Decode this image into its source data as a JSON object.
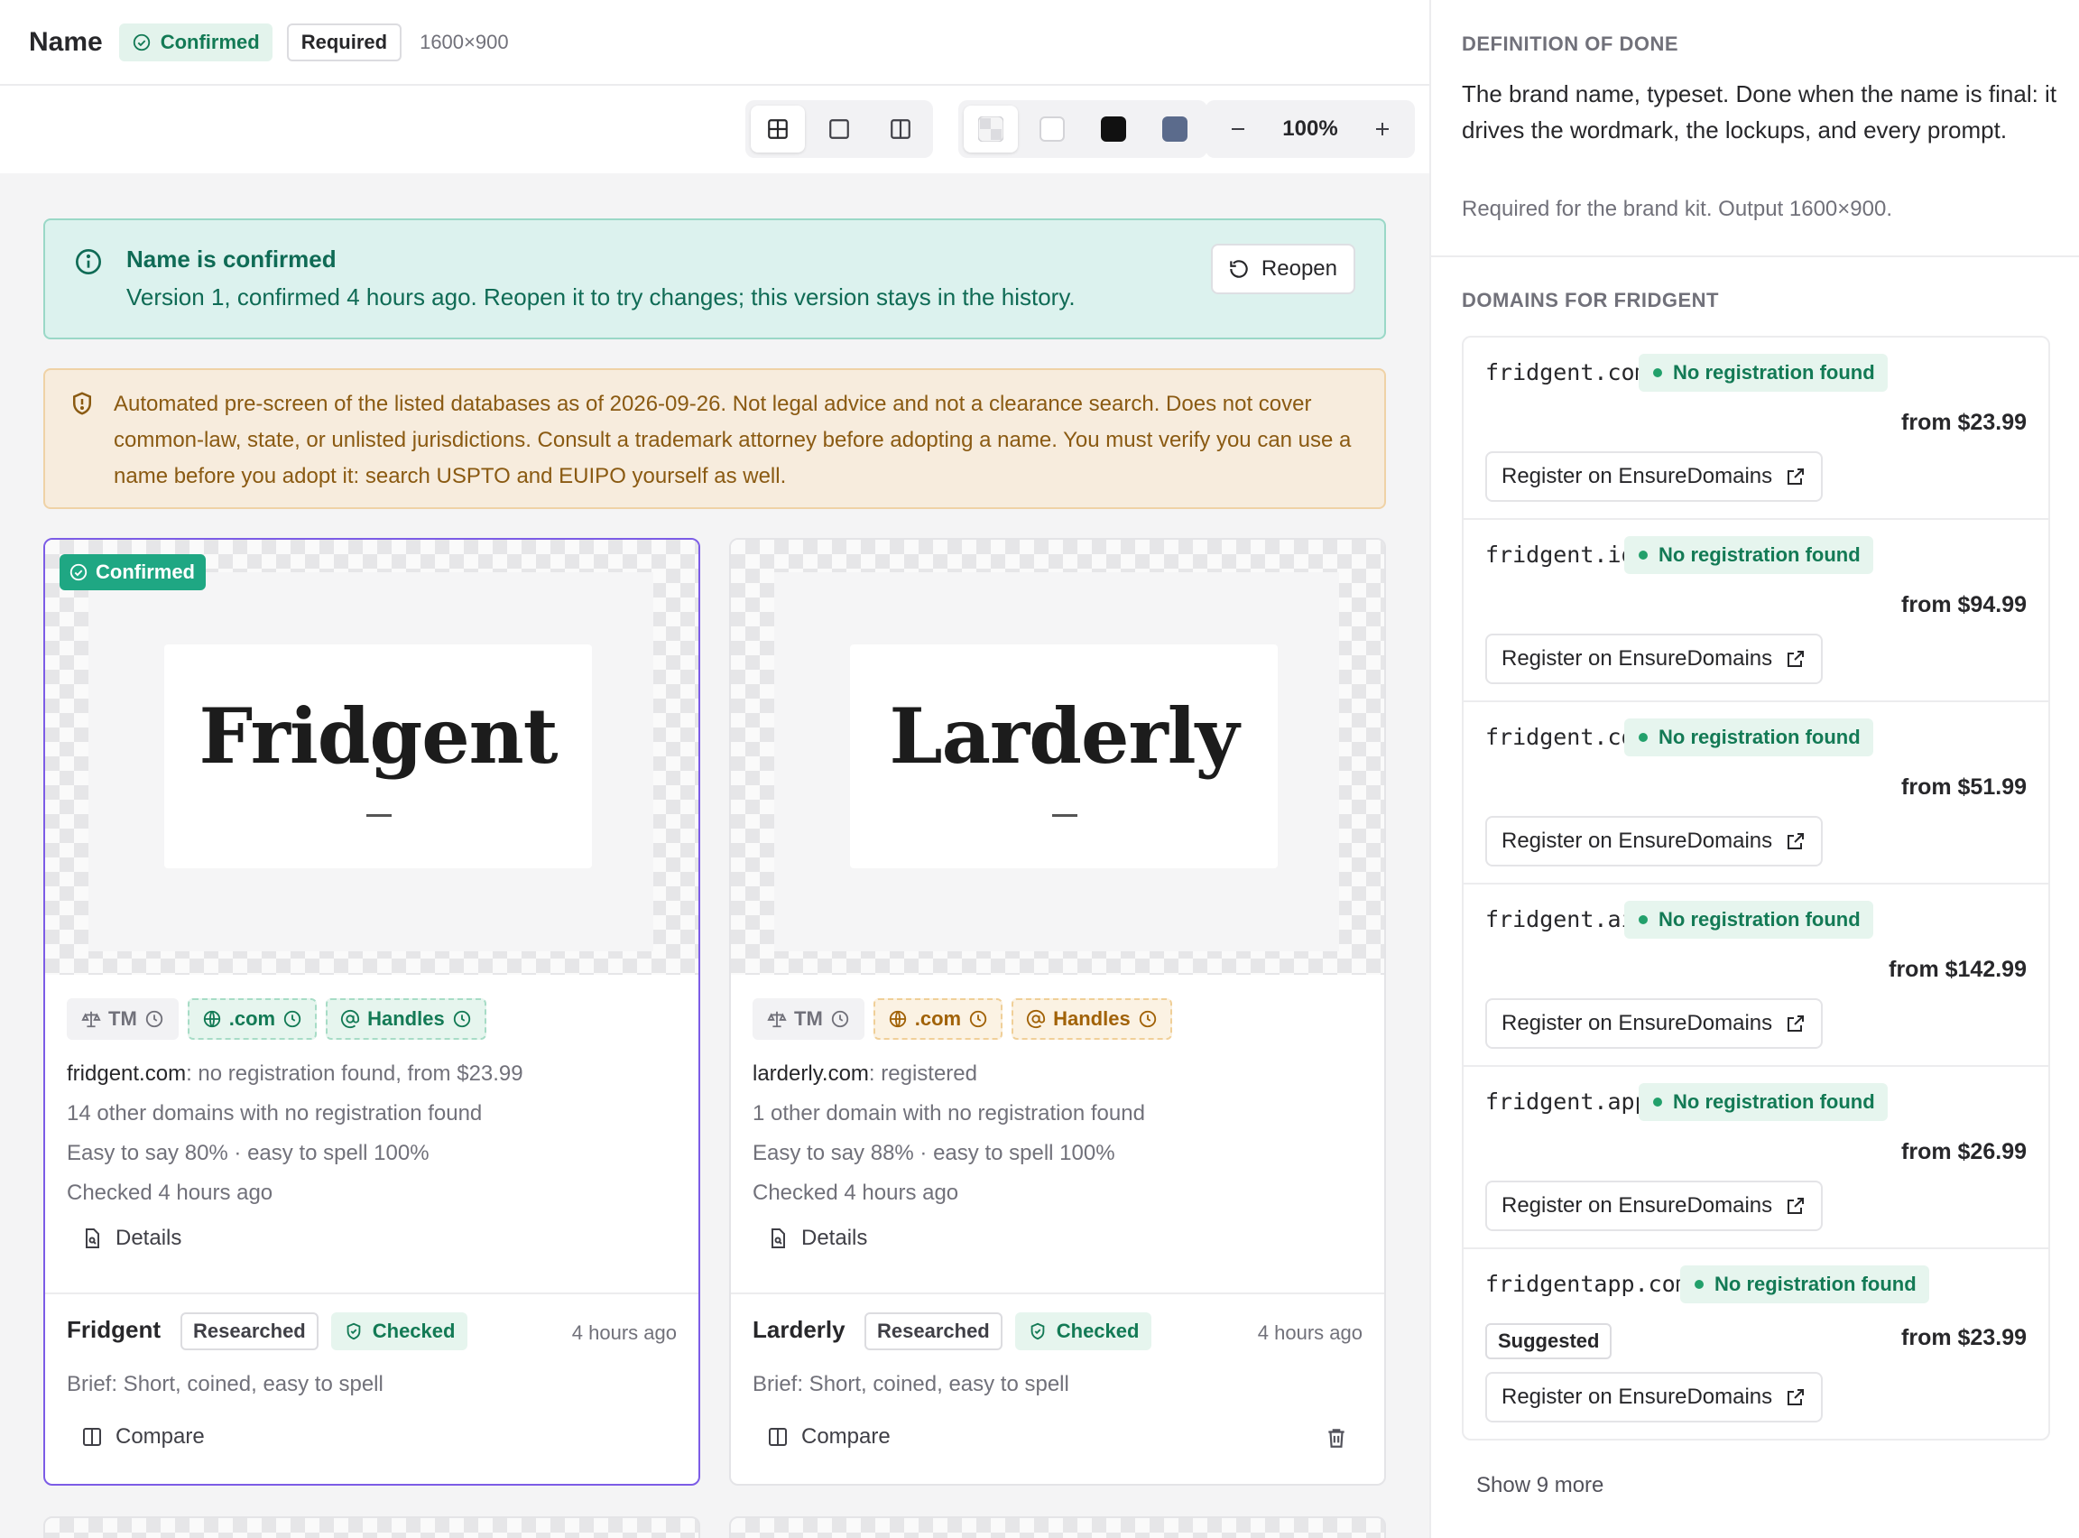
{
  "header": {
    "title": "Name",
    "status_badge": "Confirmed",
    "required_badge": "Required",
    "dimensions": "1600×900"
  },
  "toolbar": {
    "zoom": "100%",
    "swatch_colors": [
      "#f4f4f5",
      "#ffffff",
      "#111111",
      "#5b6b8c"
    ]
  },
  "confirm_banner": {
    "title": "Name is confirmed",
    "message": "Version 1, confirmed 4 hours ago. Reopen it to try changes; this version stays in the history.",
    "reopen_label": "Reopen"
  },
  "legal_banner": {
    "text": "Automated pre-screen of the listed databases as of 2026-09-26. Not legal advice and not a clearance search. Does not cover common-law, state, or unlisted jurisdictions. Consult a trademark attorney before adopting a name. You must verify you can use a name before you adopt it: search USPTO and EUIPO yourself as well."
  },
  "cards": [
    {
      "wordmark": "Fridgent",
      "confirmed_tag": "Confirmed",
      "chips": {
        "tm": "TM",
        "com": ".com",
        "handles": "Handles"
      },
      "domain_line_name": "fridgent.com",
      "domain_line_rest": ": no registration found, from $23.99",
      "other_domains": "14 other domains with no registration found",
      "ease": "Easy to say 80% · easy to spell 100%",
      "checked": "Checked 4 hours ago",
      "details_label": "Details",
      "name": "Fridgent",
      "researched": "Researched",
      "checked_tag": "Checked",
      "time": "4 hours ago",
      "brief": "Brief: Short, coined, easy to spell",
      "compare_label": "Compare"
    },
    {
      "wordmark": "Larderly",
      "chips": {
        "tm": "TM",
        "com": ".com",
        "handles": "Handles"
      },
      "domain_line_name": "larderly.com",
      "domain_line_rest": ": registered",
      "other_domains": "1 other domain with no registration found",
      "ease": "Easy to say 88% · easy to spell 100%",
      "checked": "Checked 4 hours ago",
      "details_label": "Details",
      "name": "Larderly",
      "researched": "Researched",
      "checked_tag": "Checked",
      "time": "4 hours ago",
      "brief": "Brief: Short, coined, easy to spell",
      "compare_label": "Compare"
    }
  ],
  "sidebar": {
    "dod_label": "DEFINITION OF DONE",
    "dod_text": "The brand name, typeset. Done when the name is final: it drives the wordmark, the lockups, and every prompt.",
    "dod_sub": "Required for the brand kit. Output 1600×900.",
    "domains_label": "DOMAINS FOR FRIDGENT",
    "domains": [
      {
        "name": "fridgent.com",
        "status": "No registration found",
        "price": "from $23.99",
        "register": "Register on EnsureDomains"
      },
      {
        "name": "fridgent.io",
        "status": "No registration found",
        "price": "from $94.99",
        "register": "Register on EnsureDomains"
      },
      {
        "name": "fridgent.co",
        "status": "No registration found",
        "price": "from $51.99",
        "register": "Register on EnsureDomains"
      },
      {
        "name": "fridgent.ai",
        "status": "No registration found",
        "price": "from $142.99",
        "register": "Register on EnsureDomains"
      },
      {
        "name": "fridgent.app",
        "status": "No registration found",
        "price": "from $26.99",
        "register": "Register on EnsureDomains"
      },
      {
        "name": "fridgentapp.com",
        "status": "No registration found",
        "suggested": "Suggested",
        "price": "from $23.99",
        "register": "Register on EnsureDomains"
      }
    ],
    "show_more": "Show 9 more"
  }
}
